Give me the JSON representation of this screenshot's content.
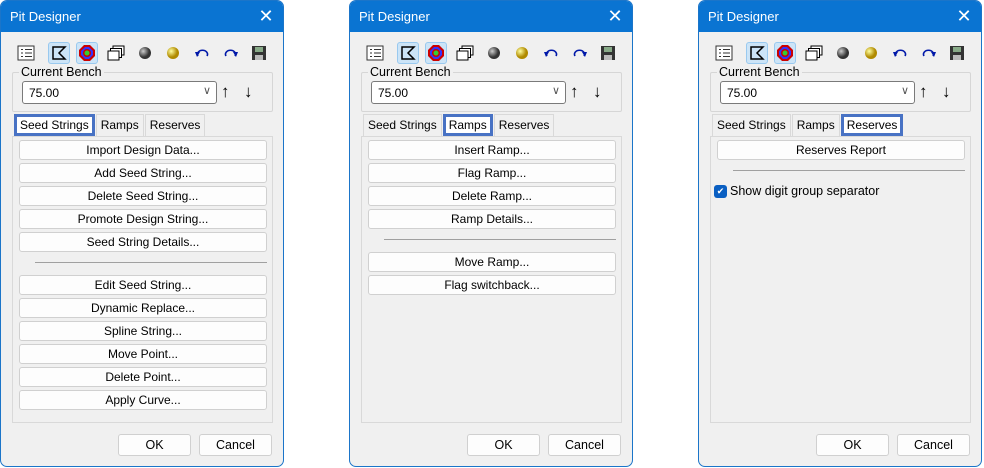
{
  "dialogs": [
    {
      "title": "Pit Designer",
      "bench_label": "Current Bench",
      "bench_value": "75.00",
      "tabs": [
        "Seed Strings",
        "Ramps",
        "Reserves"
      ],
      "active_tab": 0,
      "groups": [
        [
          "Import Design Data...",
          "Add Seed String...",
          "Delete Seed String...",
          "Promote Design String...",
          "Seed String Details..."
        ],
        [
          "Edit Seed String...",
          "Dynamic Replace...",
          "Spline String...",
          "Move Point...",
          "Delete Point...",
          "Apply Curve..."
        ]
      ],
      "ok": "OK",
      "cancel": "Cancel"
    },
    {
      "title": "Pit Designer",
      "bench_label": "Current Bench",
      "bench_value": "75.00",
      "tabs": [
        "Seed Strings",
        "Ramps",
        "Reserves"
      ],
      "active_tab": 1,
      "groups": [
        [
          "Insert Ramp...",
          "Flag Ramp...",
          "Delete Ramp...",
          "Ramp Details..."
        ],
        [
          "Move Ramp...",
          "Flag switchback..."
        ]
      ],
      "ok": "OK",
      "cancel": "Cancel"
    },
    {
      "title": "Pit Designer",
      "bench_label": "Current Bench",
      "bench_value": "75.00",
      "tabs": [
        "Seed Strings",
        "Ramps",
        "Reserves"
      ],
      "active_tab": 2,
      "groups": [
        [
          "Reserves Report"
        ]
      ],
      "checkbox": {
        "label": "Show digit group separator",
        "checked": true
      },
      "ok": "OK",
      "cancel": "Cancel"
    }
  ],
  "toolbar_icons": [
    "list-icon",
    "boundary-icon",
    "target-icon",
    "windows-icon",
    "gray-sphere-icon",
    "yellow-sphere-icon",
    "undo-icon",
    "redo-icon",
    "save-icon"
  ]
}
